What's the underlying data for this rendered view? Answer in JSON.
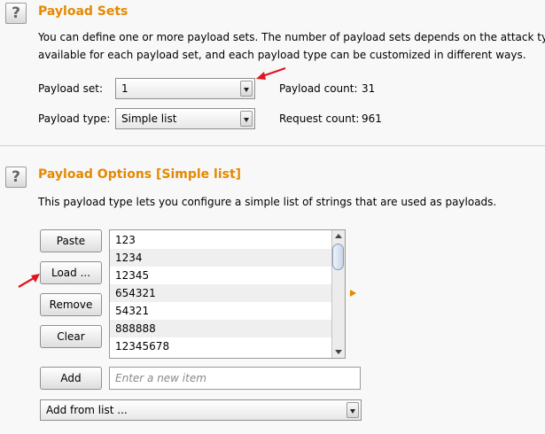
{
  "payload_sets": {
    "title": "Payload Sets",
    "description_line1": "You can define one or more payload sets. The number of payload sets depends on the attack type d",
    "description_line2": "available for each payload set, and each payload type can be customized in different ways.",
    "payload_set_label": "Payload set:",
    "payload_set_value": "1",
    "payload_type_label": "Payload type:",
    "payload_type_value": "Simple list",
    "payload_count_label": "Payload count:",
    "payload_count_value": "31",
    "request_count_label": "Request count:",
    "request_count_value": "961"
  },
  "payload_options": {
    "title": "Payload Options [Simple list]",
    "description": "This payload type lets you configure a simple list of strings that are used as payloads.",
    "buttons": {
      "paste": "Paste",
      "load": "Load ...",
      "remove": "Remove",
      "clear": "Clear",
      "add": "Add"
    },
    "list_items": [
      "123",
      "1234",
      "12345",
      "654321",
      "54321",
      "888888",
      "12345678"
    ],
    "new_item_placeholder": "Enter a new item",
    "add_from_list_label": "Add from list ..."
  },
  "help_icon_glyph": "?",
  "colors": {
    "section_title": "#e58900",
    "annotation_arrow": "#e0141e"
  }
}
